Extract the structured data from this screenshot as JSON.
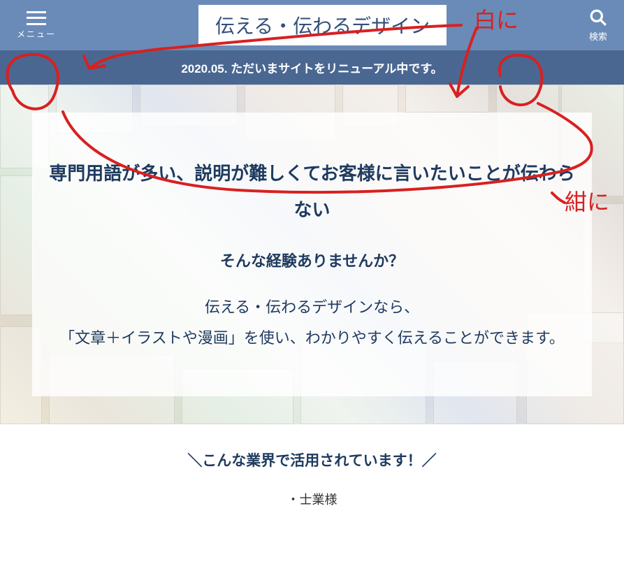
{
  "header": {
    "menu_label": "メニュー",
    "search_label": "検索",
    "logo": "伝える・伝わるデザイン"
  },
  "notice": "2020.05. ただいまサイトをリニューアル中です。",
  "hero": {
    "heading": "専門用語が多い、説明が難しくてお客様に言いたいことが伝わらない",
    "sub": "そんな経験ありませんか？",
    "body": "伝える・伝わるデザインなら、\n「文章＋イラストや漫画」を使い、わかりやすく伝えることができます。"
  },
  "section": {
    "title": "＼こんな業界で活用されています！／",
    "items": [
      "・士業様"
    ]
  },
  "annotations": {
    "note_white": "白に",
    "note_navy": "紺に"
  }
}
